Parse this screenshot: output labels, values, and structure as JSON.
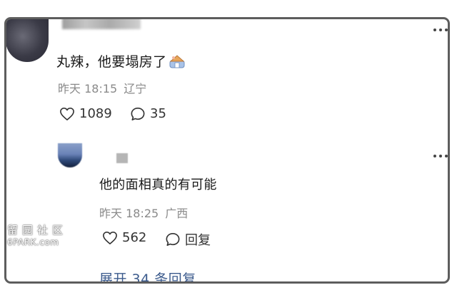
{
  "comment": {
    "text": "丸辣，他要塌房了",
    "time": "昨天 18:15",
    "location": "辽宁",
    "likes": "1089",
    "replies": "35"
  },
  "reply": {
    "text": "他的面相真的有可能",
    "time": "昨天 18:25",
    "location": "广西",
    "likes": "562",
    "reply_label": "回复"
  },
  "expand_label": "展开 34 条回复",
  "watermark": {
    "cn": "留园社区",
    "en": "6PARK.com"
  },
  "colors": {
    "text": "#1a1a1a",
    "meta": "#8a8a8a",
    "link": "#3b5a8c",
    "border": "#5d5d5d"
  },
  "icons": [
    "heart-icon",
    "comment-bubble-icon",
    "more-dots-icon",
    "house-emoji-icon"
  ]
}
